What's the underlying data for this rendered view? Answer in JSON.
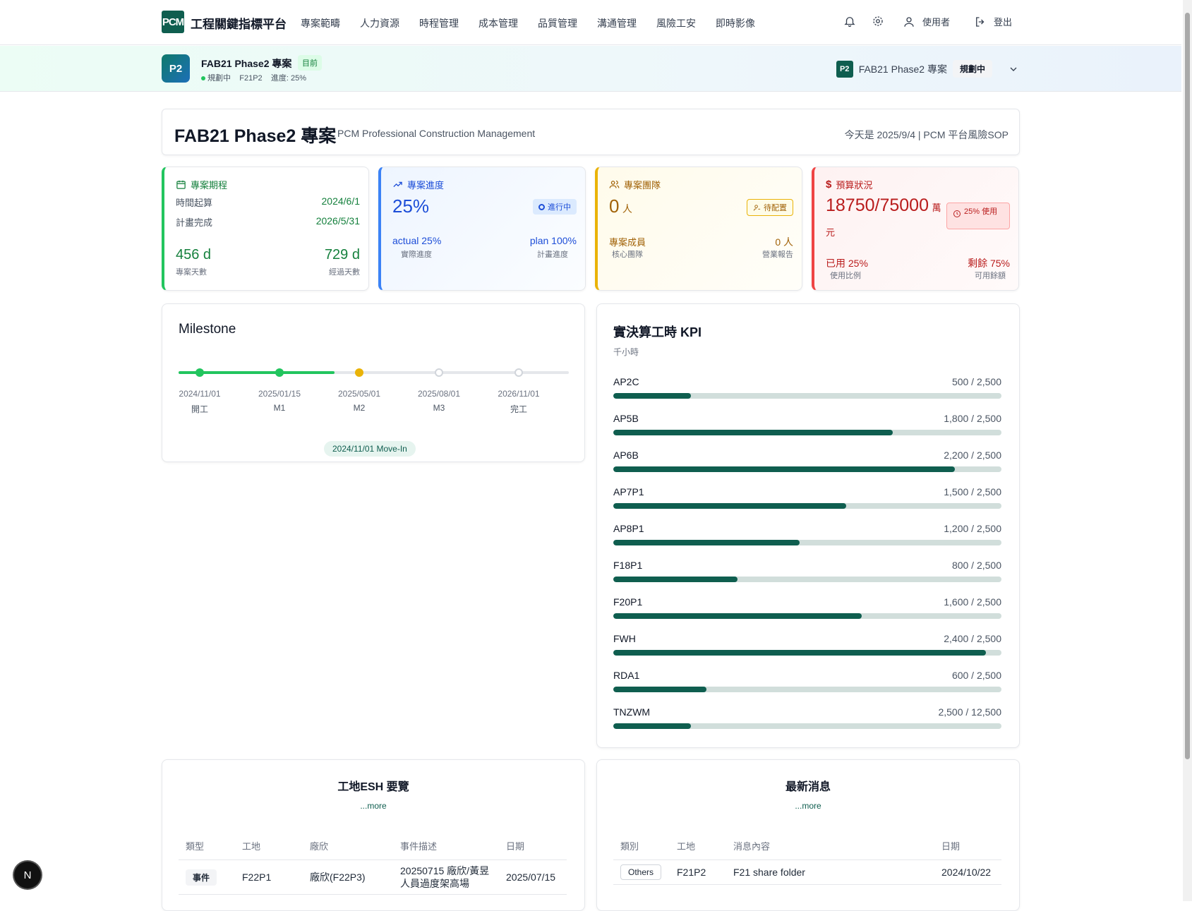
{
  "nav": {
    "logo": "PCM",
    "title": "工程關鍵指標平台",
    "menu": [
      "專案範疇",
      "人力資源",
      "時程管理",
      "成本管理",
      "品質管理",
      "溝通管理",
      "風險工安",
      "即時影像"
    ],
    "user_label": "使用者",
    "logout_label": "登出"
  },
  "project_bar": {
    "badge": "P2",
    "name": "FAB21 Phase2 專案",
    "current_tag": "目前",
    "status": "規劃中",
    "code": "F21P2",
    "progress": "進度: 25%",
    "selector_badge": "P2",
    "selector_name": "FAB21 Phase2 專案",
    "selector_status": "規劃中"
  },
  "header": {
    "title": "FAB21 Phase2 專案",
    "subtitle": "PCM Professional Construction Management",
    "right_text": "今天是 2025/9/4 | PCM 平台風險SOP"
  },
  "stats": {
    "schedule": {
      "label": "專案期程",
      "start_label": "時間起算",
      "start_value": "2024/6/1",
      "end_label": "計畫完成",
      "end_value": "2026/5/31",
      "total_days": "456 d",
      "total_days_label": "專案天數",
      "elapsed_days": "729 d",
      "elapsed_days_label": "經過天數"
    },
    "progress": {
      "label": "專案進度",
      "value": "25%",
      "status": "進行中",
      "actual": "actual 25%",
      "actual_label": "實際進度",
      "plan": "plan 100%",
      "plan_label": "計畫進度"
    },
    "team": {
      "label": "專案團隊",
      "value": "0",
      "unit": "人",
      "status": "待配置",
      "members": "專案成員",
      "members_label": "核心團隊",
      "report_value": "0 人",
      "report_label": "營業報告"
    },
    "budget": {
      "label": "預算狀況",
      "value": "18750/75000",
      "unit": "萬",
      "unit2": "元",
      "badge": "25% 使用",
      "used": "已用 25%",
      "used_label": "使用比例",
      "remain": "剩餘 75%",
      "remain_label": "可用餘額"
    }
  },
  "milestone": {
    "title": "Milestone",
    "done_fraction": 0.4,
    "points": [
      {
        "date": "2024/11/01",
        "name": "開工",
        "state": "done"
      },
      {
        "date": "2025/01/15",
        "name": "M1",
        "state": "done"
      },
      {
        "date": "2025/05/01",
        "name": "M2",
        "state": "current"
      },
      {
        "date": "2025/08/01",
        "name": "M3",
        "state": "pending"
      },
      {
        "date": "2026/11/01",
        "name": "完工",
        "state": "pending"
      }
    ],
    "move_in": "2024/11/01 Move-In"
  },
  "kpi": {
    "title": "實決算工時 KPI",
    "unit": "千小時",
    "rows": [
      {
        "name": "AP2C",
        "label": "500 / 2,500",
        "value": 500,
        "max": 2500
      },
      {
        "name": "AP5B",
        "label": "1,800 / 2,500",
        "value": 1800,
        "max": 2500
      },
      {
        "name": "AP6B",
        "label": "2,200 / 2,500",
        "value": 2200,
        "max": 2500
      },
      {
        "name": "AP7P1",
        "label": "1,500 / 2,500",
        "value": 1500,
        "max": 2500
      },
      {
        "name": "AP8P1",
        "label": "1,200 / 2,500",
        "value": 1200,
        "max": 2500
      },
      {
        "name": "F18P1",
        "label": "800 / 2,500",
        "value": 800,
        "max": 2500
      },
      {
        "name": "F20P1",
        "label": "1,600 / 2,500",
        "value": 1600,
        "max": 2500
      },
      {
        "name": "FWH",
        "label": "2,400 / 2,500",
        "value": 2400,
        "max": 2500
      },
      {
        "name": "RDA1",
        "label": "600 / 2,500",
        "value": 600,
        "max": 2500
      },
      {
        "name": "TNZWM",
        "label": "2,500 / 12,500",
        "value": 2500,
        "max": 12500
      }
    ]
  },
  "esh": {
    "title": "工地ESH 要覽",
    "more": "...more",
    "headers": [
      "類型",
      "工地",
      "廠欣",
      "事件描述",
      "日期"
    ],
    "rows": [
      {
        "type": "事件",
        "site": "F22P1",
        "vendor": "廠欣(F22P3)",
        "desc": "20250715 廠欣/黃昱人員過度架高場",
        "date": "2025/07/15"
      }
    ]
  },
  "news": {
    "title": "最新消息",
    "more": "...more",
    "headers": [
      "類別",
      "工地",
      "消息內容",
      "日期"
    ],
    "rows": [
      {
        "category": "Others",
        "site": "F21P2",
        "content": "F21 share folder",
        "date": "2024/10/22"
      }
    ]
  },
  "misc": {
    "dev_badge": "N"
  },
  "colors": {
    "brand": "#0f5e4f",
    "green": "#22c55e",
    "blue": "#3b82f6",
    "yellow": "#eab308",
    "red": "#ef4444"
  }
}
